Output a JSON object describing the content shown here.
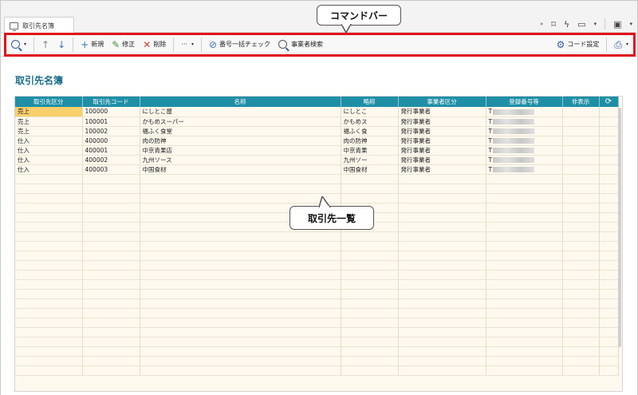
{
  "tab": {
    "label": "取引先名簿"
  },
  "toolbar": {
    "new_label": "新規",
    "edit_label": "修正",
    "delete_label": "削除",
    "more_label": "···",
    "bulk_number_check_label": "番号一括チェック",
    "business_search_label": "事業者検索",
    "code_setting_label": "コード設定"
  },
  "callouts": {
    "command_bar": "コマンドバー",
    "partner_list": "取引先一覧"
  },
  "page": {
    "title": "取引先名簿"
  },
  "table": {
    "headers": [
      "取引先区分",
      "取引先コード",
      "名称",
      "略称",
      "事業者区分",
      "登録番号等",
      "非表示"
    ],
    "rows": [
      {
        "kubun": "売上",
        "code": "100000",
        "name": "にしとこ屋",
        "short": "にしとこ",
        "biz": "発行事業者",
        "reg": "T"
      },
      {
        "kubun": "売上",
        "code": "100001",
        "name": "かもめスーパー",
        "short": "かもめス",
        "biz": "発行事業者",
        "reg": "T"
      },
      {
        "kubun": "売上",
        "code": "100002",
        "name": "福ふく食堂",
        "short": "福ふく食",
        "biz": "発行事業者",
        "reg": "T"
      },
      {
        "kubun": "仕入",
        "code": "400000",
        "name": "肉の防神",
        "short": "肉の防神",
        "biz": "発行事業者",
        "reg": "T"
      },
      {
        "kubun": "仕入",
        "code": "400001",
        "name": "中京青果店",
        "short": "中京青果",
        "biz": "発行事業者",
        "reg": "T"
      },
      {
        "kubun": "仕入",
        "code": "400002",
        "name": "九州ソース",
        "short": "九州ソー",
        "biz": "発行事業者",
        "reg": "T"
      },
      {
        "kubun": "仕入",
        "code": "400003",
        "name": "中国食材",
        "short": "中国食材",
        "biz": "発行事業者",
        "reg": "T"
      }
    ]
  },
  "colors": {
    "accent": "#1f8fa6",
    "title": "#1b6f8c",
    "highlight": "#e0101a",
    "grid_bg": "#fdf9ee"
  }
}
